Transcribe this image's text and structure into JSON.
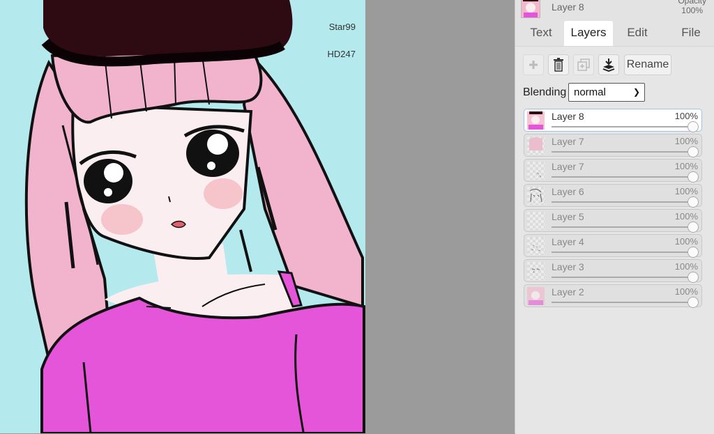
{
  "canvas": {
    "watermark_line1": "Star99",
    "watermark_line2": "HD247",
    "colors": {
      "background": "#b4e9ee",
      "hair": "#f2b3cc",
      "skin": "#fbeef1",
      "shirt": "#e455d9",
      "hat": "#2e0a12"
    }
  },
  "current_layer": {
    "name": "Layer 8",
    "opacity_label": "Opacity",
    "opacity_value": "100%"
  },
  "tabs": [
    {
      "label": "Text",
      "active": false
    },
    {
      "label": "Layers",
      "active": true
    },
    {
      "label": "Edit",
      "active": false
    },
    {
      "label": "File",
      "active": false
    }
  ],
  "toolbar": {
    "add_icon": "plus-icon",
    "delete_icon": "trash-icon",
    "duplicate_icon": "duplicate-icon",
    "merge_icon": "merge-down-icon",
    "rename_label": "Rename"
  },
  "blending": {
    "label": "Blending",
    "value": "normal"
  },
  "layers": [
    {
      "name": "Layer 8",
      "opacity": "100%",
      "active": true
    },
    {
      "name": "Layer 7",
      "opacity": "100%",
      "active": false
    },
    {
      "name": "Layer 7",
      "opacity": "100%",
      "active": false
    },
    {
      "name": "Layer 6",
      "opacity": "100%",
      "active": false
    },
    {
      "name": "Layer 5",
      "opacity": "100%",
      "active": false
    },
    {
      "name": "Layer 4",
      "opacity": "100%",
      "active": false
    },
    {
      "name": "Layer 3",
      "opacity": "100%",
      "active": false
    },
    {
      "name": "Layer 2",
      "opacity": "100%",
      "active": false
    }
  ]
}
